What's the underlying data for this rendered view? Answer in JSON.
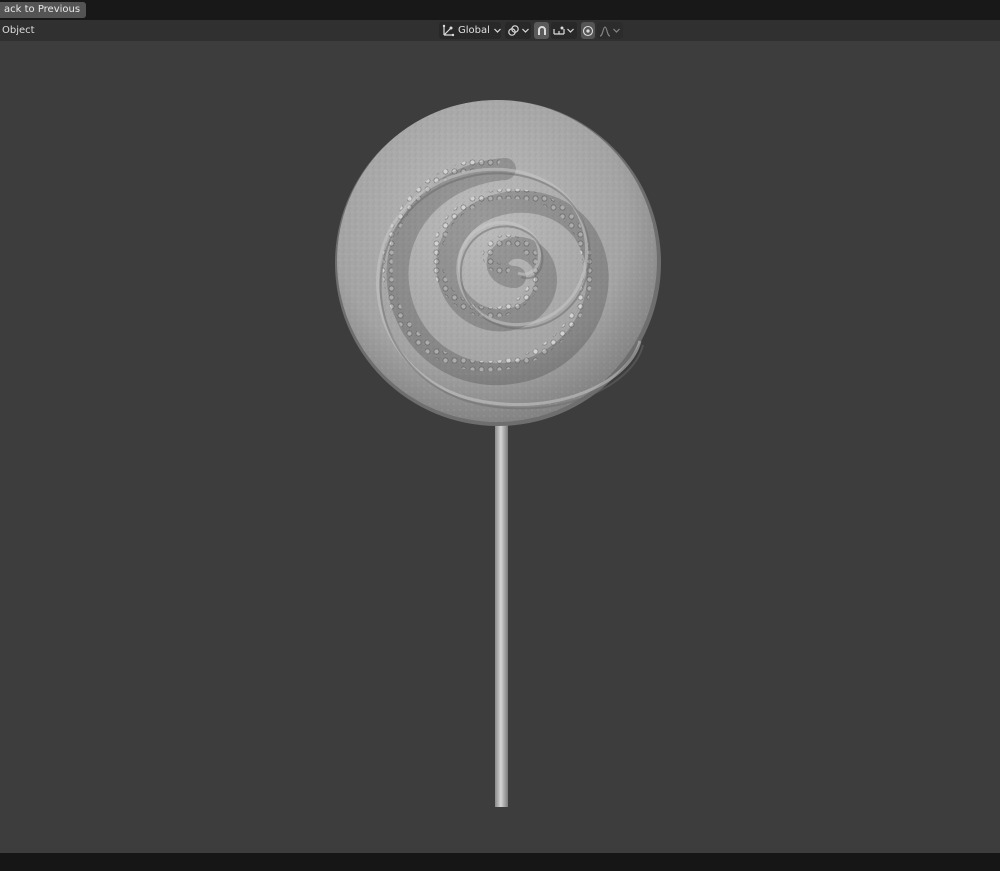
{
  "topbar": {
    "back_button_label": "ack to Previous"
  },
  "header": {
    "mode_label": "Object",
    "transform_orientation": {
      "value": "Global",
      "icon": "orientation-axes-icon"
    },
    "pivot_point": {
      "icon": "pivot-link-icon"
    },
    "snapping": {
      "toggle_icon": "snap-magnet-icon",
      "target_icon": "snap-increment-icon"
    },
    "proportional_editing": {
      "toggle_icon": "proportional-circle-icon",
      "falloff_icon": "falloff-curve-icon"
    }
  },
  "colors": {
    "viewport_bg": "#3d3d3d",
    "header_bg": "#303030",
    "topbar_bg": "#181818",
    "model_gray": "#a8a8a8",
    "active_toggle": "#5a5a5a"
  }
}
